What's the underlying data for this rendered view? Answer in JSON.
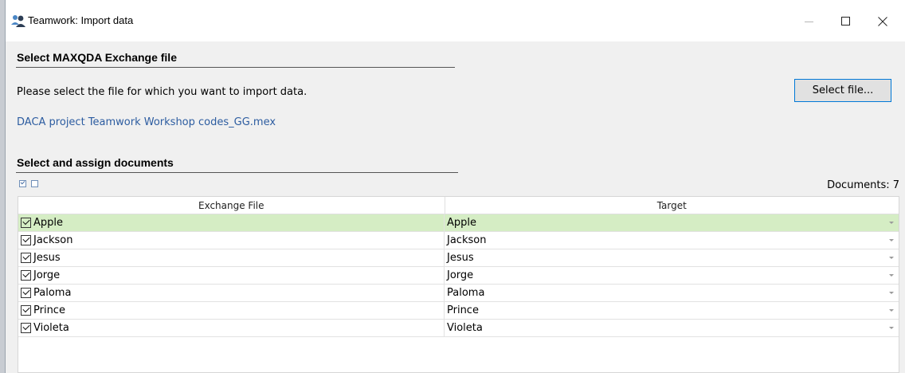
{
  "window": {
    "title": "Teamwork: Import data",
    "icon": "teamwork-users-icon"
  },
  "section_file": {
    "title": "Select MAXQDA Exchange file",
    "prompt": "Please select the file for which you want to import data.",
    "button_label": "Select file...",
    "selected_file": "DACA project Teamwork Workshop codes_GG.mex"
  },
  "section_docs": {
    "title": "Select and assign documents",
    "documents_count": "Documents: 7",
    "columns": [
      "Exchange File",
      "Target"
    ],
    "rows": [
      {
        "source": "Apple",
        "target": "Apple",
        "checked": true,
        "selected": true
      },
      {
        "source": "Jackson",
        "target": "Jackson",
        "checked": true,
        "selected": false
      },
      {
        "source": "Jesus",
        "target": "Jesus",
        "checked": true,
        "selected": false
      },
      {
        "source": "Jorge",
        "target": "Jorge",
        "checked": true,
        "selected": false
      },
      {
        "source": "Paloma",
        "target": "Paloma",
        "checked": true,
        "selected": false
      },
      {
        "source": "Prince",
        "target": "Prince",
        "checked": true,
        "selected": false
      },
      {
        "source": "Violeta",
        "target": "Violeta",
        "checked": true,
        "selected": false
      }
    ]
  },
  "colors": {
    "selected_row": "#d5edc4",
    "link": "#2c5ca0",
    "button_border": "#0078d7"
  }
}
